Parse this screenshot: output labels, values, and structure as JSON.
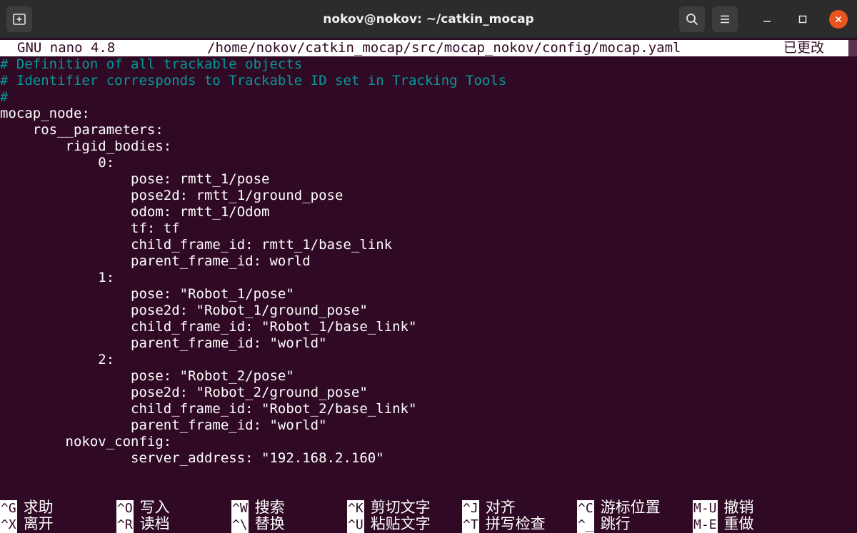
{
  "window": {
    "title": "nokov@nokov: ~/catkin_mocap",
    "icons": {
      "new_tab": "new-tab-icon",
      "search": "search-icon",
      "menu": "hamburger-menu-icon",
      "minimize": "minimize-icon",
      "maximize": "maximize-icon",
      "close": "close-icon"
    },
    "colors": {
      "terminal_bg": "#300a24",
      "comment": "#06989a",
      "close_button": "#e95420"
    }
  },
  "nano": {
    "version": "GNU nano 4.8",
    "file_path": "/home/nokov/catkin_mocap/src/mocap_nokov/config/mocap.yaml",
    "status": "已更改"
  },
  "editor": {
    "lines": [
      {
        "text": "# Definition of all trackable objects",
        "type": "comment"
      },
      {
        "text": "# Identifier corresponds to Trackable ID set in Tracking Tools",
        "type": "comment"
      },
      {
        "text": "#",
        "type": "comment"
      },
      {
        "text": "mocap_node:",
        "type": "plain"
      },
      {
        "text": "    ros__parameters:",
        "type": "plain"
      },
      {
        "text": "        rigid_bodies:",
        "type": "plain"
      },
      {
        "text": "            0:",
        "type": "plain"
      },
      {
        "text": "                pose: rmtt_1/pose",
        "type": "plain"
      },
      {
        "text": "                pose2d: rmtt_1/ground_pose",
        "type": "plain"
      },
      {
        "text": "                odom: rmtt_1/Odom",
        "type": "plain"
      },
      {
        "text": "                tf: tf",
        "type": "plain"
      },
      {
        "text": "                child_frame_id: rmtt_1/base_link",
        "type": "plain"
      },
      {
        "text": "                parent_frame_id: world",
        "type": "plain"
      },
      {
        "text": "            1:",
        "type": "plain"
      },
      {
        "text": "                pose: \"Robot_1/pose\"",
        "type": "plain"
      },
      {
        "text": "                pose2d: \"Robot_1/ground_pose\"",
        "type": "plain"
      },
      {
        "text": "                child_frame_id: \"Robot_1/base_link\"",
        "type": "plain"
      },
      {
        "text": "                parent_frame_id: \"world\"",
        "type": "plain"
      },
      {
        "text": "            2:",
        "type": "plain"
      },
      {
        "text": "                pose: \"Robot_2/pose\"",
        "type": "plain"
      },
      {
        "text": "                pose2d: \"Robot_2/ground_pose\"",
        "type": "plain"
      },
      {
        "text": "                child_frame_id: \"Robot_2/base_link\"",
        "type": "plain"
      },
      {
        "text": "                parent_frame_id: \"world\"",
        "type": "plain"
      },
      {
        "text": "        nokov_config:",
        "type": "plain"
      },
      {
        "text": "                server_address: \"192.168.2.160\"",
        "type": "plain"
      }
    ]
  },
  "shortcuts": [
    {
      "key": "^G",
      "label": "求助"
    },
    {
      "key": "^O",
      "label": "写入"
    },
    {
      "key": "^W",
      "label": "搜索"
    },
    {
      "key": "^K",
      "label": "剪切文字"
    },
    {
      "key": "^J",
      "label": "对齐"
    },
    {
      "key": "^C",
      "label": "游标位置"
    },
    {
      "key": "M-U",
      "label": "撤销"
    },
    {
      "key": "^X",
      "label": "离开"
    },
    {
      "key": "^R",
      "label": "读档"
    },
    {
      "key": "^\\",
      "label": "替换"
    },
    {
      "key": "^U",
      "label": "粘贴文字"
    },
    {
      "key": "^T",
      "label": "拼写检查"
    },
    {
      "key": "^_",
      "label": "跳行"
    },
    {
      "key": "M-E",
      "label": "重做"
    }
  ]
}
